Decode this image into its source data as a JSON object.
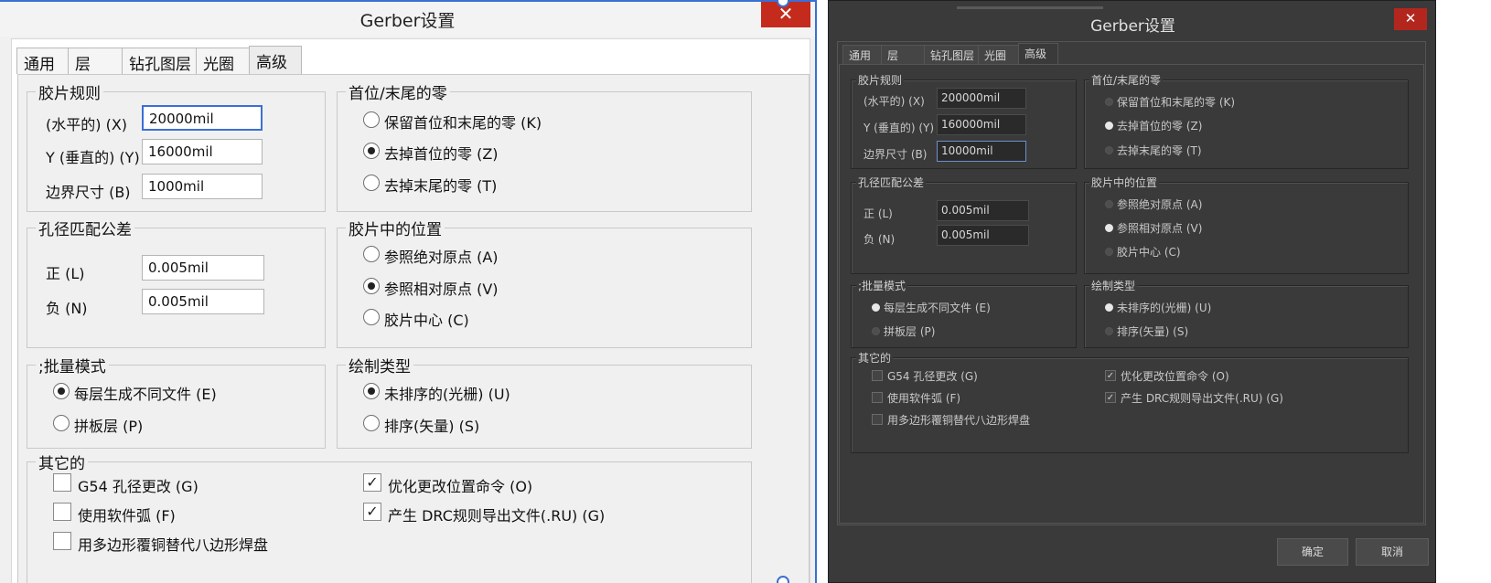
{
  "light": {
    "title": "Gerber设置",
    "close": "✕",
    "tabs": [
      "通用",
      "层",
      "钻孔图层",
      "光圈",
      "高级"
    ],
    "film": {
      "title": "胶片规则",
      "x_label": "(水平的) (X)",
      "x_value": "20000mil",
      "y_label": "Y (垂直的) (Y)",
      "y_value": "16000mil",
      "b_label": "边界尺寸 (B)",
      "b_value": "1000mil"
    },
    "zeros": {
      "title": "首位/末尾的零",
      "options": [
        "保留首位和末尾的零 (K)",
        "去掉首位的零 (Z)",
        "去掉末尾的零 (T)"
      ]
    },
    "aperture": {
      "title": "孔径匹配公差",
      "plus_label": "正 (L)",
      "plus_value": "0.005mil",
      "minus_label": "负 (N)",
      "minus_value": "0.005mil"
    },
    "position": {
      "title": "胶片中的位置",
      "options": [
        "参照绝对原点 (A)",
        "参照相对原点 (V)",
        "胶片中心 (C)"
      ]
    },
    "batch": {
      "title": ";批量模式",
      "options": [
        "每层生成不同文件 (E)",
        "拼板层 (P)"
      ]
    },
    "plot": {
      "title": "绘制类型",
      "options": [
        "未排序的(光栅) (U)",
        "排序(矢量) (S)"
      ]
    },
    "other": {
      "title": "其它的",
      "g54": "G54 孔径更改 (G)",
      "arc": "使用软件弧 (F)",
      "poly": "用多边形覆铜替代八边形焊盘",
      "optimize": "优化更改位置命令 (O)",
      "drc": "产生 DRC规则导出文件(.RU) (G)",
      "check": "✓"
    }
  },
  "dark": {
    "title": "Gerber设置",
    "close": "✕",
    "tabs": [
      "通用",
      "层",
      "钻孔图层",
      "光圈",
      "高级"
    ],
    "film": {
      "title": "胶片规则",
      "x_label": "(水平的) (X)",
      "x_value": "200000mil",
      "y_label": "Y (垂直的) (Y)",
      "y_value": "160000mil",
      "b_label": "边界尺寸 (B)",
      "b_value": "10000mil"
    },
    "zeros": {
      "title": "首位/末尾的零",
      "options": [
        "保留首位和末尾的零 (K)",
        "去掉首位的零 (Z)",
        "去掉末尾的零 (T)"
      ]
    },
    "aperture": {
      "title": "孔径匹配公差",
      "plus_label": "正 (L)",
      "plus_value": "0.005mil",
      "minus_label": "负 (N)",
      "minus_value": "0.005mil"
    },
    "position": {
      "title": "胶片中的位置",
      "options": [
        "参照绝对原点 (A)",
        "参照相对原点 (V)",
        "胶片中心 (C)"
      ]
    },
    "batch": {
      "title": ";批量模式",
      "options": [
        "每层生成不同文件 (E)",
        "拼板层 (P)"
      ]
    },
    "plot": {
      "title": "绘制类型",
      "options": [
        "未排序的(光栅) (U)",
        "排序(矢量) (S)"
      ]
    },
    "other": {
      "title": "其它的",
      "g54": "G54 孔径更改 (G)",
      "arc": "使用软件弧 (F)",
      "poly": "用多边形覆铜替代八边形焊盘",
      "optimize": "优化更改位置命令 (O)",
      "drc": "产生 DRC规则导出文件(.RU) (G)",
      "check": "✓"
    },
    "ok": "确定",
    "cancel": "取消"
  },
  "colors": {
    "accent": "#3b6fd4",
    "close_red": "#c42b1c",
    "dark_bg": "#3a3a3a"
  }
}
